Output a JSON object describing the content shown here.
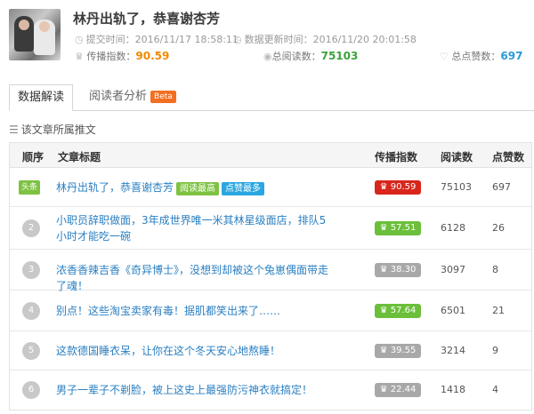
{
  "article": {
    "title": "林丹出轨了，恭喜谢杏芳",
    "submit_label": "提交时间：2016/11/17 18:58:11",
    "update_label": "数据更新时间：2016/11/20 20:01:58",
    "spread_label": "传播指数：",
    "spread_value": "90.59",
    "reads_label": "总阅读数：",
    "reads_value": "75103",
    "likes_label": "总点赞数：",
    "likes_value": "697"
  },
  "tabs": {
    "data": "数据解读",
    "readers": "阅读者分析",
    "beta": "Beta"
  },
  "section_title": "该文章所属推文",
  "table": {
    "headers": [
      "顺序",
      "文章标题",
      "传播指数",
      "阅读数",
      "点赞数"
    ],
    "rows": [
      {
        "rank": "头条",
        "title": "林丹出轨了，恭喜谢杏芳",
        "tags": [
          "阅读最高",
          "点赞最多"
        ],
        "index": "90.59",
        "index_color": "red",
        "reads": "75103",
        "likes": "697"
      },
      {
        "rank": "2",
        "title": "小职员辞职做面，3年成世界唯一米其林星级面店，排队5小时才能吃一碗",
        "tags": [],
        "index": "57.51",
        "index_color": "green",
        "reads": "6128",
        "likes": "26"
      },
      {
        "rank": "3",
        "title": "浓香香辣吉香《奇异博士》，没想到却被这个兔崽偶面带走了魂！",
        "tags": [],
        "index": "38.30",
        "index_color": "gray",
        "reads": "3097",
        "likes": "8"
      },
      {
        "rank": "4",
        "title": "别点！这些淘宝卖家有毒！据肌都笑出来了……",
        "tags": [],
        "index": "57.64",
        "index_color": "green",
        "reads": "6501",
        "likes": "21"
      },
      {
        "rank": "5",
        "title": "这款德国睡衣呆，让你在这个冬天安心地熬睡！",
        "tags": [],
        "index": "39.55",
        "index_color": "gray",
        "reads": "3214",
        "likes": "9"
      },
      {
        "rank": "6",
        "title": "男子一辈子不剃脸，被上这史上最强防污神衣就搞定！",
        "tags": [],
        "index": "22.44",
        "index_color": "gray",
        "reads": "1418",
        "likes": "4"
      }
    ]
  }
}
